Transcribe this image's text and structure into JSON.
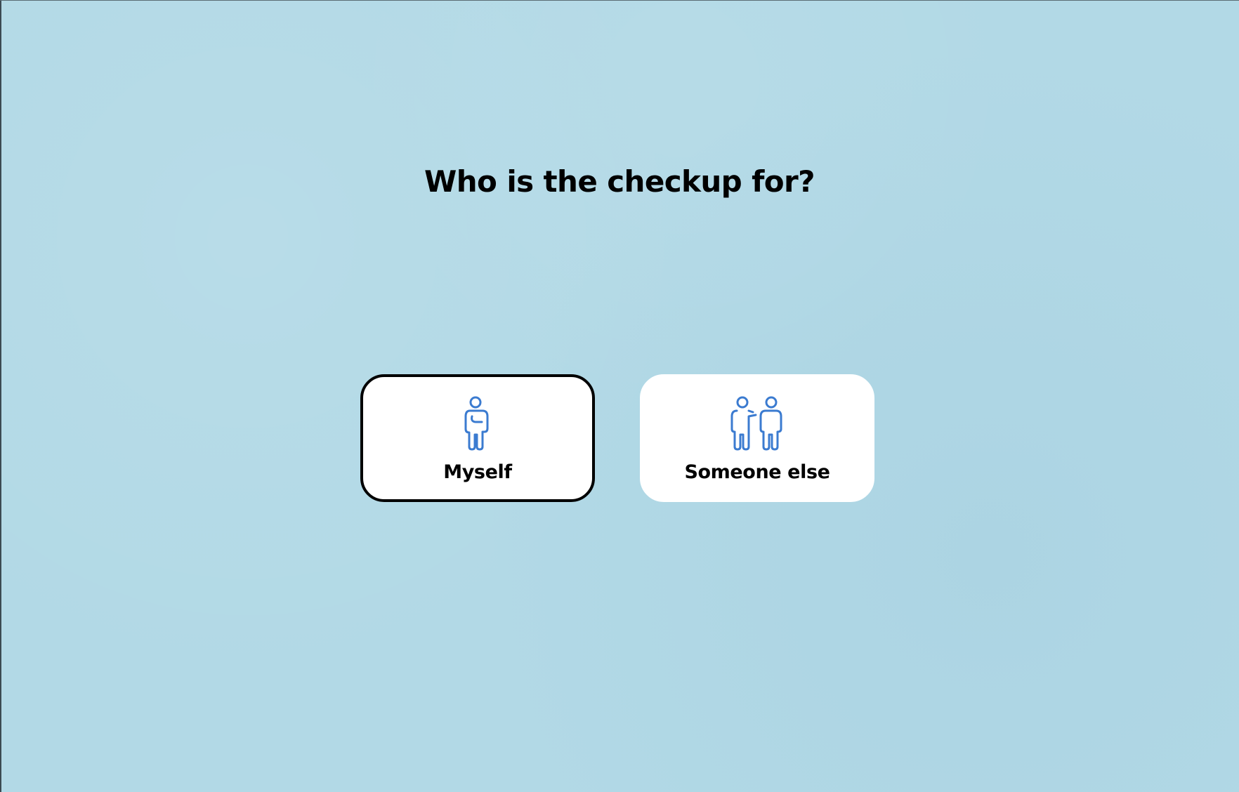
{
  "page": {
    "title": "Who is the checkup for?"
  },
  "options": [
    {
      "label": "Myself",
      "icon": "person-icon",
      "selected": true
    },
    {
      "label": "Someone else",
      "icon": "two-people-icon",
      "selected": false
    }
  ],
  "colors": {
    "background": "#b2d9e6",
    "card": "#ffffff",
    "selected_border": "#000000",
    "icon_stroke": "#3b7bd0",
    "text": "#000000"
  }
}
